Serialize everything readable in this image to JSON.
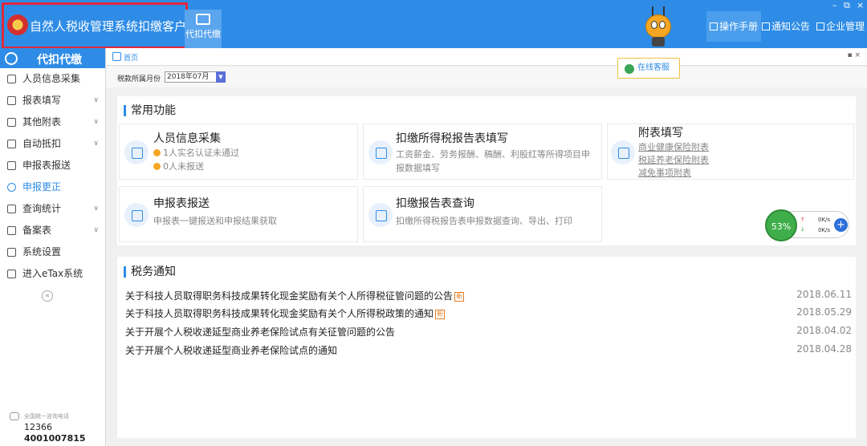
{
  "header": {
    "app_title": "自然人税收管理系统扣缴客户端",
    "nav_tile_label": "代扣代缴",
    "buttons": [
      {
        "label": "操作手册"
      },
      {
        "label": "通知公告"
      },
      {
        "label": "企业管理"
      }
    ],
    "window_controls": [
      "–",
      "⧉",
      "×"
    ]
  },
  "sidebar": {
    "title": "代扣代缴",
    "items": [
      {
        "label": "人员信息采集",
        "icon": "person-icon",
        "expandable": false
      },
      {
        "label": "报表填写",
        "icon": "edit-icon",
        "expandable": true
      },
      {
        "label": "其他附表",
        "icon": "grid-icon",
        "expandable": true
      },
      {
        "label": "自动抵扣",
        "icon": "target-icon",
        "expandable": true
      },
      {
        "label": "申报表报送",
        "icon": "doc-icon",
        "expandable": false
      },
      {
        "label": "申报更正",
        "icon": "search-icon",
        "expandable": false,
        "active": true
      },
      {
        "label": "查询统计",
        "icon": "stats-icon",
        "expandable": true
      },
      {
        "label": "备案表",
        "icon": "file-icon",
        "expandable": true
      },
      {
        "label": "系统设置",
        "icon": "gear-icon",
        "expandable": false
      },
      {
        "label": "进入eTax系统",
        "icon": "compass-icon",
        "expandable": false
      }
    ],
    "collapse_glyph": "«",
    "hotline": {
      "caption": "全国统一咨询电话",
      "number1": "12366",
      "number2": "4001007815"
    }
  },
  "tab": {
    "label": "首页",
    "controls": "▪ ×"
  },
  "filter": {
    "label": "税款所属月份",
    "value": "2018年07月",
    "arrow": "▼"
  },
  "online_service": {
    "label": "在线客服"
  },
  "common": {
    "title": "常用功能",
    "cards": [
      {
        "title": "人员信息采集",
        "line1": "1人实名认证未通过",
        "line2": "0人未报送"
      },
      {
        "title": "扣缴所得税报告表填写",
        "desc1": "工资薪金、劳务报酬、稿酬、利股红等所得项目申",
        "desc2": "报数据填写"
      },
      {
        "title": "附表填写",
        "link1": "商业健康保险附表",
        "link2": "税延养老保险附表",
        "link3": "减免事项附表"
      },
      {
        "title": "申报表报送",
        "desc1": "申报表一键报送和申报结果获取"
      },
      {
        "title": "扣缴报告表查询",
        "desc1": "扣缴所得税报告表申报数据查询、导出、打印"
      }
    ]
  },
  "netmonitor": {
    "percent": "53%",
    "up": "0K/s",
    "down": "0K/s",
    "up_arrow": "↑",
    "down_arrow": "↓",
    "plus": "+"
  },
  "notices": {
    "title": "税务通知",
    "new_badge": "新",
    "items": [
      {
        "text": "关于科技人员取得职务科技成果转化现金奖励有关个人所得税征管问题的公告",
        "date": "2018.06.11",
        "is_new": true
      },
      {
        "text": "关于科技人员取得职务科技成果转化现金奖励有关个人所得税政策的通知",
        "date": "2018.05.29",
        "is_new": true
      },
      {
        "text": "关于开展个人税收递延型商业养老保险试点有关征管问题的公告",
        "date": "2018.04.02",
        "is_new": false
      },
      {
        "text": "关于开展个人税收递延型商业养老保险试点的通知",
        "date": "2018.04.28",
        "is_new": false
      }
    ]
  }
}
